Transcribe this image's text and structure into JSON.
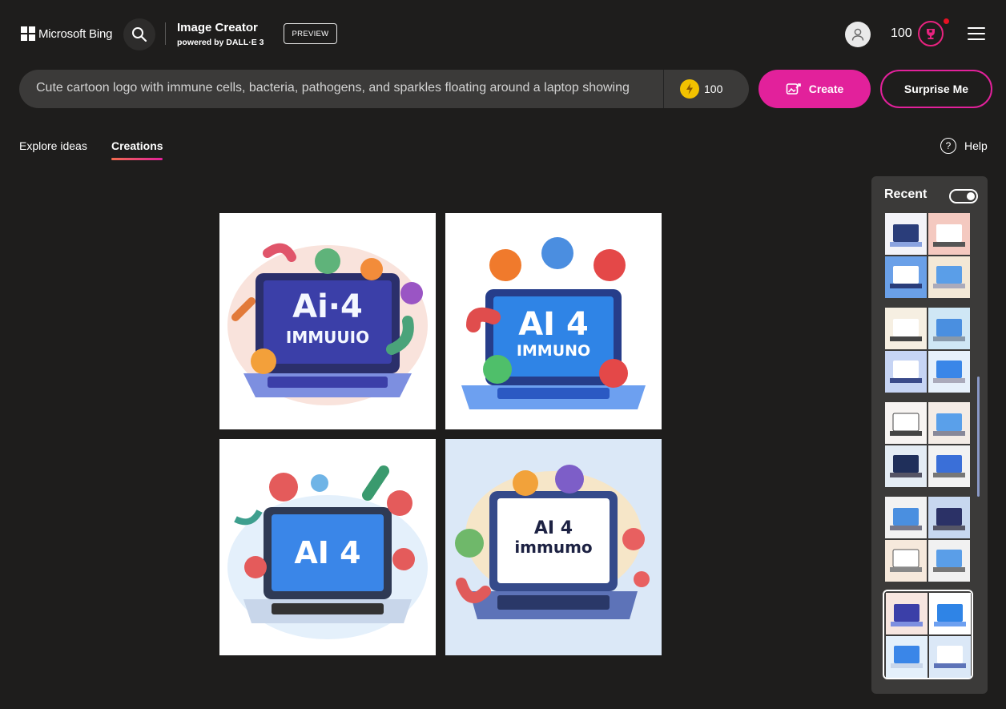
{
  "header": {
    "brand": "Microsoft Bing",
    "app_title": "Image Creator",
    "powered_by": "powered by DALL·E 3",
    "preview_badge": "PREVIEW",
    "coin_count": "100"
  },
  "prompt": {
    "text": "Cute cartoon logo with immune cells, bacteria, pathogens, and sparkles floating around a laptop showing",
    "boost_count": "100"
  },
  "buttons": {
    "create": "Create",
    "surprise": "Surprise Me"
  },
  "tabs": {
    "explore": "Explore ideas",
    "creations": "Creations"
  },
  "help": "Help",
  "images": [
    {
      "screen_text_1": "Ai·4",
      "screen_text_2": "IMMUUIO",
      "bg": "#ffffff",
      "screen": "#3b3fa8"
    },
    {
      "screen_text_1": "AI 4",
      "screen_text_2": "IMMUNO",
      "bg": "#ffffff",
      "screen": "#2f84e6"
    },
    {
      "screen_text_1": "AI 4",
      "screen_text_2": "",
      "bg": "#ffffff",
      "screen": "#3a86e8"
    },
    {
      "screen_text_1": "AI 4",
      "screen_text_2": "immumo",
      "bg": "#dbe8f7",
      "screen": "#ffffff"
    }
  ],
  "recent": {
    "title": "Recent"
  },
  "colors": {
    "accent": "#e2219b",
    "background": "#1e1d1c",
    "panel": "#3b3a39"
  }
}
